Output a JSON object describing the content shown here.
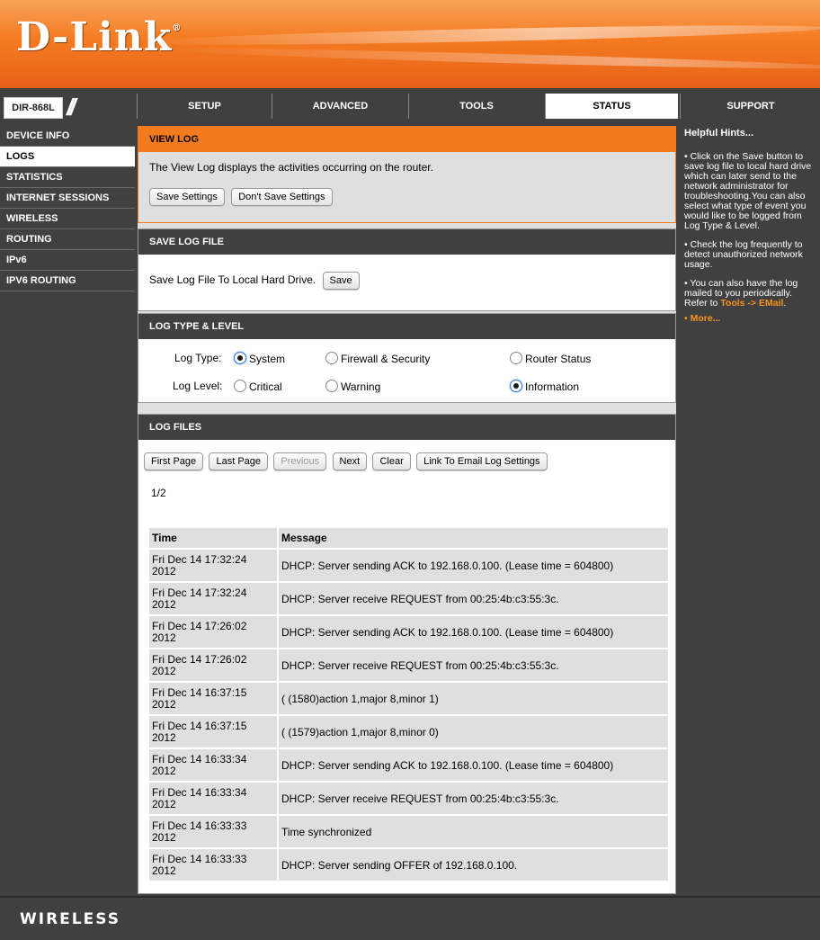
{
  "brand": {
    "logo": "D-Link",
    "reg": "®",
    "model": "DIR-868L",
    "slashes": "//"
  },
  "topnav": [
    {
      "label": "SETUP"
    },
    {
      "label": "ADVANCED"
    },
    {
      "label": "TOOLS"
    },
    {
      "label": "STATUS",
      "active": true
    },
    {
      "label": "SUPPORT"
    }
  ],
  "leftnav": [
    {
      "label": "DEVICE INFO"
    },
    {
      "label": "LOGS",
      "active": true
    },
    {
      "label": "STATISTICS"
    },
    {
      "label": "INTERNET SESSIONS"
    },
    {
      "label": "WIRELESS"
    },
    {
      "label": "ROUTING"
    },
    {
      "label": "IPv6"
    },
    {
      "label": "IPV6 ROUTING"
    }
  ],
  "viewlog": {
    "title": "VIEW LOG",
    "description": "The View Log displays the activities occurring on the router.",
    "save_settings": "Save Settings",
    "dont_save": "Don't Save Settings"
  },
  "savefile": {
    "title": "SAVE LOG FILE",
    "label": "Save Log File To Local Hard Drive.",
    "save": "Save"
  },
  "logtype": {
    "title": "LOG TYPE & LEVEL",
    "type_label": "Log Type:",
    "level_label": "Log Level:",
    "types": [
      "System",
      "Firewall & Security",
      "Router Status"
    ],
    "levels": [
      "Critical",
      "Warning",
      "Information"
    ],
    "selected_type": "System",
    "selected_level": "Information"
  },
  "logfiles": {
    "title": "LOG FILES",
    "buttons": {
      "first": "First Page",
      "last": "Last Page",
      "previous": "Previous",
      "next": "Next",
      "clear": "Clear",
      "email": "Link To Email Log Settings"
    },
    "page": "1/2",
    "headers": {
      "time": "Time",
      "message": "Message"
    },
    "rows": [
      {
        "t1": "Fri Dec 14 17:32:24",
        "t2": "2012",
        "msg": "DHCP: Server sending ACK to 192.168.0.100. (Lease time = 604800)"
      },
      {
        "t1": "Fri Dec 14 17:32:24",
        "t2": "2012",
        "msg": "DHCP: Server receive REQUEST from 00:25:4b:c3:55:3c."
      },
      {
        "t1": "Fri Dec 14 17:26:02",
        "t2": "2012",
        "msg": "DHCP: Server sending ACK to 192.168.0.100. (Lease time = 604800)"
      },
      {
        "t1": "Fri Dec 14 17:26:02",
        "t2": "2012",
        "msg": "DHCP: Server receive REQUEST from 00:25:4b:c3:55:3c."
      },
      {
        "t1": "Fri Dec 14 16:37:15",
        "t2": "2012",
        "msg": "( (1580)action 1,major 8,minor 1)"
      },
      {
        "t1": "Fri Dec 14 16:37:15",
        "t2": "2012",
        "msg": "( (1579)action 1,major 8,minor 0)"
      },
      {
        "t1": "Fri Dec 14 16:33:34",
        "t2": "2012",
        "msg": "DHCP: Server sending ACK to 192.168.0.100. (Lease time = 604800)"
      },
      {
        "t1": "Fri Dec 14 16:33:34",
        "t2": "2012",
        "msg": "DHCP: Server receive REQUEST from 00:25:4b:c3:55:3c."
      },
      {
        "t1": "Fri Dec 14 16:33:33",
        "t2": "2012",
        "msg": "Time synchronized"
      },
      {
        "t1": "Fri Dec 14 16:33:33",
        "t2": "2012",
        "msg": "DHCP: Server sending OFFER of 192.168.0.100."
      }
    ]
  },
  "hints": {
    "title": "Helpful Hints...",
    "h1": "• Click on the Save button to save log file to local hard drive which can later send to the network administrator for troubleshooting.You can also select what type of event you would like to be logged from Log Type & Level.",
    "h2": "• Check the log frequently to detect unauthorized network usage.",
    "h3": "• You can also have the log mailed to you periodically. Refer to",
    "h3link": "Tools -> EMail",
    "h3end": ".",
    "more": "• More..."
  },
  "footer": {
    "label": "WIRELESS"
  }
}
